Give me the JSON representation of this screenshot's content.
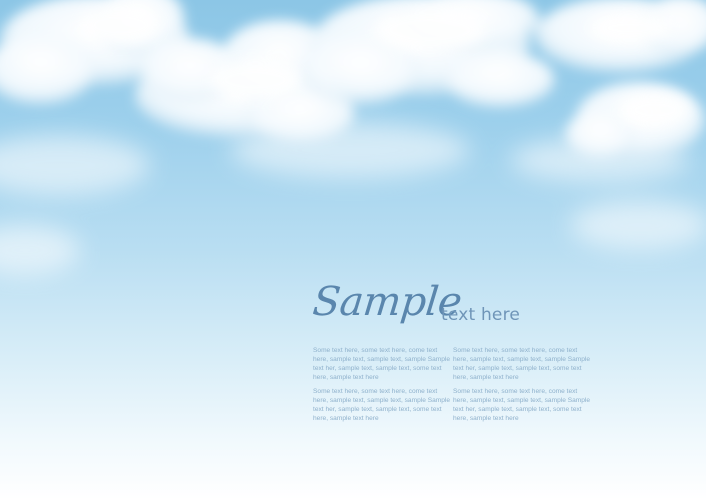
{
  "headline": {
    "script": "Sample",
    "subtitle": "text here"
  },
  "paragraphs": [
    "Some text here, some text here, come text here, sample text, sample text, sample Sample text her, sample text, sample text, some text here, sample text here",
    "Some text here, some text here, come text here, sample text, sample text, sample Sample text her, sample text, sample text, some text here, sample text here",
    "Some text here, some text here, come text here, sample text, sample text, sample Sample text her, sample text, sample text, some text here, sample text here",
    "Some text here, some text here, come text here, sample text, sample text, sample Sample text her, sample text, sample text, some text here, sample text here"
  ],
  "colors": {
    "sky_top": "#8cc6e6",
    "sky_bottom": "#ffffff",
    "headline": "#5a86ad",
    "body_text": "#8fb1cc"
  }
}
